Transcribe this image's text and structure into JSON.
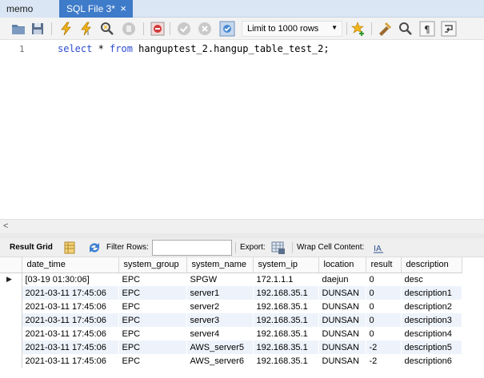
{
  "tabs": [
    {
      "label": "memo",
      "close": ""
    },
    {
      "label": "SQL File 3*",
      "close": "×"
    }
  ],
  "toolbar": {
    "icons": [
      "open-folder-icon",
      "save-icon",
      "execute-icon",
      "execute-current-icon",
      "explain-icon",
      "stop-icon",
      "toggle-continue-icon",
      "commit-icon",
      "rollback-icon",
      "autocommit-icon",
      "beautify-icon",
      "search-icon",
      "invisible-chars-icon",
      "word-wrap-icon"
    ],
    "limit_value": "Limit to 1000 rows"
  },
  "editor": {
    "line_number": "1",
    "kw_select": "select",
    "star": " * ",
    "kw_from": "from",
    "rest": " hanguptest_2.hangup_table_test_2;"
  },
  "scroll_arrow": "<",
  "result_toolbar": {
    "result_grid": "Result Grid",
    "filter_rows": "Filter Rows:",
    "filter_value": "",
    "export": "Export:",
    "wrap": "Wrap Cell Content:"
  },
  "grid": {
    "columns": [
      "date_time",
      "system_group",
      "system_name",
      "system_ip",
      "location",
      "result",
      "description"
    ],
    "current_marker": "▶",
    "rows": [
      [
        "[03-19 01:30:06]",
        "EPC",
        "SPGW",
        "172.1.1.1",
        "daejun",
        "0",
        "desc"
      ],
      [
        "2021-03-11 17:45:06",
        "EPC",
        "server1",
        "192.168.35.1",
        "DUNSAN",
        "0",
        "description1"
      ],
      [
        "2021-03-11 17:45:06",
        "EPC",
        "server2",
        "192.168.35.1",
        "DUNSAN",
        "0",
        "description2"
      ],
      [
        "2021-03-11 17:45:06",
        "EPC",
        "server3",
        "192.168.35.1",
        "DUNSAN",
        "0",
        "description3"
      ],
      [
        "2021-03-11 17:45:06",
        "EPC",
        "server4",
        "192.168.35.1",
        "DUNSAN",
        "0",
        "description4"
      ],
      [
        "2021-03-11 17:45:06",
        "EPC",
        "AWS_server5",
        "192.168.35.1",
        "DUNSAN",
        "-2",
        "description5"
      ],
      [
        "2021-03-11 17:45:06",
        "EPC",
        "AWS_server6",
        "192.168.35.1",
        "DUNSAN",
        "-2",
        "description6"
      ]
    ]
  },
  "colors": {
    "accent_tab": "#3e7bc9",
    "keyword": "#2a4bd0",
    "alt_row": "#eef3fb"
  }
}
